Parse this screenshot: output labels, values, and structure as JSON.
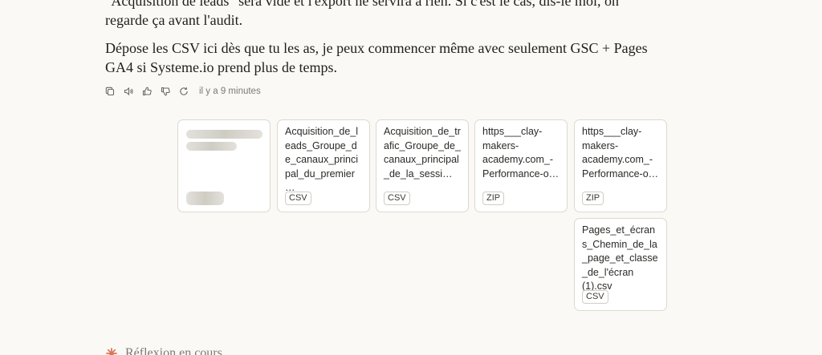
{
  "message": {
    "paragraph_1": "\"Acquisition de leads\" sera vide et l'export ne servira à rien. Si c'est le cas, dis-le moi, on regarde ça avant l'audit.",
    "paragraph_2": "Dépose les CSV ici dès que tu les as, je peux commencer même avec seulement GSC + Pages GA4 si Systeme.io prend plus de temps."
  },
  "actions": {
    "icons": [
      "copy-icon",
      "speaker-icon",
      "thumbs-up-icon",
      "thumbs-down-icon",
      "retry-icon"
    ],
    "timestamp": "il y a 9 minutes"
  },
  "attachments": [
    {
      "name": "Acquisition_de_leads_Groupe_de_canaux_principal_du_premier…",
      "type": "CSV"
    },
    {
      "name": "Acquisition_de_trafic_Groupe_de_canaux_principal_de_la_sessi…",
      "type": "CSV"
    },
    {
      "name": "https___clay-makers-academy.com_-Performance-o…",
      "type": "ZIP"
    },
    {
      "name": "https___clay-makers-academy.com_-Performance-o…",
      "type": "ZIP"
    },
    {
      "name": "Pages_et_écrans_Chemin_de_la_page_et_classe_de_l'écran (1).csv",
      "type": "CSV"
    }
  ],
  "status": {
    "thinking_label": "Réflexion en cours",
    "accent_color": "#d97757"
  }
}
